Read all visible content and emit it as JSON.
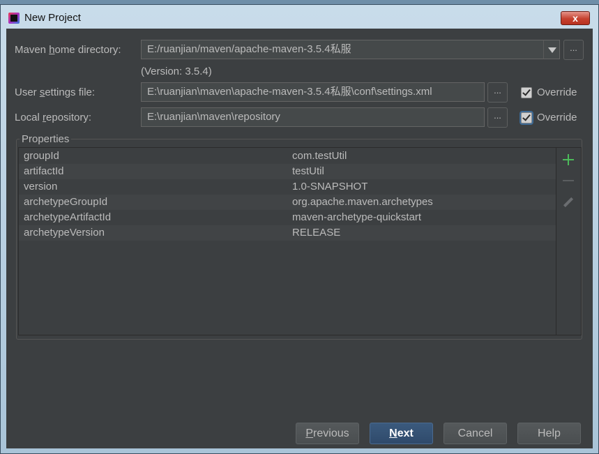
{
  "window": {
    "title": "New Project",
    "close_label": "x"
  },
  "maven_home": {
    "label_pre": "Maven ",
    "label_mnemonic": "h",
    "label_post": "ome directory:",
    "value": "E:/ruanjian/maven/apache-maven-3.5.4私服",
    "version": "(Version: 3.5.4)",
    "browse_label": "..."
  },
  "user_settings": {
    "label_pre": "User ",
    "label_mnemonic": "s",
    "label_post": "ettings file:",
    "value": "E:\\ruanjian\\maven\\apache-maven-3.5.4私服\\conf\\settings.xml",
    "browse_label": "...",
    "override_label": "Override",
    "override_checked": true
  },
  "local_repo": {
    "label_pre": "Local ",
    "label_mnemonic": "r",
    "label_post": "epository:",
    "value": "E:\\ruanjian\\maven\\repository",
    "browse_label": "...",
    "override_label": "Override",
    "override_checked": true
  },
  "properties": {
    "title": "Properties",
    "rows": [
      {
        "key": "groupId",
        "value": "com.testUtil"
      },
      {
        "key": "artifactId",
        "value": "testUtil"
      },
      {
        "key": "version",
        "value": "1.0-SNAPSHOT"
      },
      {
        "key": "archetypeGroupId",
        "value": "org.apache.maven.archetypes"
      },
      {
        "key": "archetypeArtifactId",
        "value": "maven-archetype-quickstart"
      },
      {
        "key": "archetypeVersion",
        "value": "RELEASE"
      }
    ]
  },
  "buttons": {
    "previous_mnemonic": "P",
    "previous_rest": "revious",
    "next_mnemonic": "N",
    "next_rest": "ext",
    "cancel": "Cancel",
    "help": "Help"
  },
  "colors": {
    "client_bg": "#3c3f41",
    "accent": "#2f4a6b",
    "add_icon": "#4cbb5a"
  }
}
